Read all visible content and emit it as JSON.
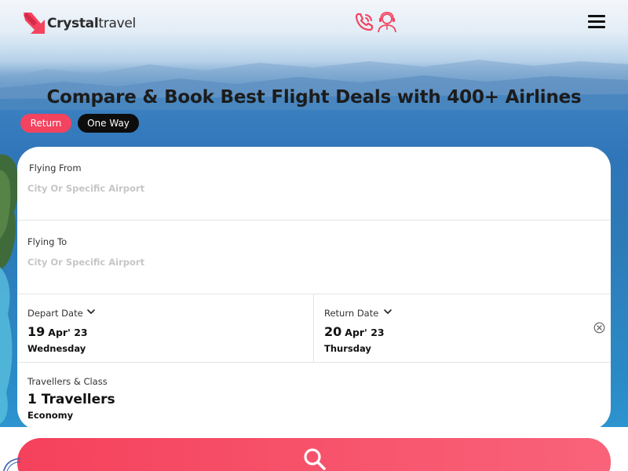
{
  "brand": {
    "name_bold": "Crystal",
    "name_light": "travel",
    "accent": "#f4435f"
  },
  "header": {
    "icons": [
      "logo-icon",
      "phone-icon",
      "support-agent-icon",
      "hamburger-menu-icon"
    ]
  },
  "headline": "Compare & Book Best Flight Deals with 400+ Airlines",
  "trip_types": {
    "return_label": "Return",
    "oneway_label": "One Way",
    "selected": "Return"
  },
  "search": {
    "from": {
      "label": "Flying From",
      "placeholder": "City Or Specific Airport",
      "value": ""
    },
    "to": {
      "label": "Flying To",
      "placeholder": "City Or Specific Airport",
      "value": ""
    },
    "depart": {
      "label": "Depart Date",
      "day": "19",
      "month": "Apr' 23",
      "weekday": "Wednesday"
    },
    "return": {
      "label": "Return Date",
      "day": "20",
      "month": "Apr' 23",
      "weekday": "Thursday"
    },
    "travellers": {
      "label": "Travellers & Class",
      "count": "1 Travellers",
      "class": "Economy"
    }
  },
  "colors": {
    "pill_return": "#f4435f",
    "pill_oneway": "#0d0d0d",
    "button_start": "#f5415c",
    "button_end": "#f9637a"
  }
}
